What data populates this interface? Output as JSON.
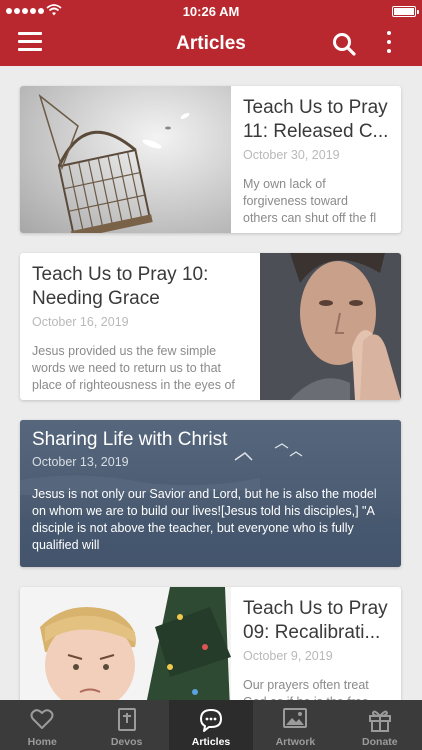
{
  "status_bar": {
    "time": "10:26 AM"
  },
  "header": {
    "title": "Articles",
    "menu_icon": "hamburger-icon",
    "search_icon": "search-icon",
    "more_icon": "more-vertical-icon",
    "color": "#b8282e"
  },
  "articles": [
    {
      "title": "Teach Us to Pray 11: Released C...",
      "date": "October 30, 2019",
      "excerpt": [
        "My own lack of",
        "forgiveness toward",
        "others can shut off the fl"
      ]
    },
    {
      "title_lines": [
        "Teach Us to Pray 10:",
        "Needing Grace"
      ],
      "date": "October 16, 2019",
      "excerpt": [
        "Jesus provided us the few simple",
        "words we need to return us to that",
        "place of righteousness in the eyes of"
      ]
    },
    {
      "title": "Sharing Life with Christ",
      "date": "October 13, 2019",
      "excerpt": [
        "Jesus is not only our Savior and Lord, but he is also the model",
        "on whom we are to build our lives![Jesus told his disciples,] \"A",
        "disciple is not above the teacher, but everyone who is fully",
        "qualified will"
      ]
    },
    {
      "title": "Teach Us to Pray 09: Recalibrati...",
      "date": "October 9, 2019",
      "excerpt": [
        "Our prayers often treat",
        "God as if he is the free"
      ]
    }
  ],
  "tabs": [
    {
      "label": "Home",
      "icon": "heart-icon"
    },
    {
      "label": "Devos",
      "icon": "bible-icon"
    },
    {
      "label": "Articles",
      "icon": "chat-bubble-icon",
      "active": true
    },
    {
      "label": "Artwork",
      "icon": "image-icon"
    },
    {
      "label": "Donate",
      "icon": "gift-icon"
    }
  ]
}
